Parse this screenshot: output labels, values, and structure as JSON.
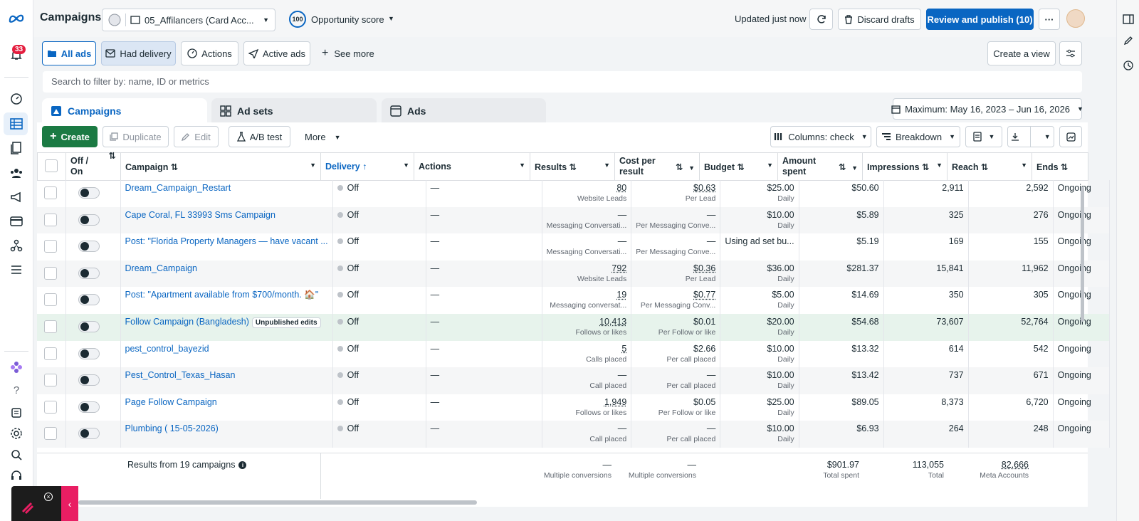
{
  "app": {
    "title": "Campaigns",
    "notif_count": "33"
  },
  "header": {
    "account_name": "05_Affilancers (Card Acc...",
    "opportunity_score": "100",
    "opportunity_label": "Opportunity score",
    "updated": "Updated just now",
    "discard": "Discard drafts",
    "publish": "Review and publish (10)",
    "more": "···"
  },
  "filters": {
    "all_ads": "All ads",
    "had_delivery": "Had delivery",
    "actions": "Actions",
    "active_ads": "Active ads",
    "see_more": "See more",
    "create_view": "Create a view"
  },
  "search": {
    "placeholder": "Search to filter by: name, ID or metrics"
  },
  "levels": {
    "campaigns": "Campaigns",
    "adsets": "Ad sets",
    "ads": "Ads"
  },
  "date_range": "Maximum: May 16, 2023 – Jun 16, 2026",
  "toolbar": {
    "create": "Create",
    "duplicate": "Duplicate",
    "edit": "Edit",
    "ab_test": "A/B test",
    "more": "More",
    "columns": "Columns: check",
    "breakdown": "Breakdown"
  },
  "columns": {
    "offon": "Off / On",
    "campaign": "Campaign",
    "delivery": "Delivery",
    "actions": "Actions",
    "results": "Results",
    "cost": "Cost per result",
    "budget": "Budget",
    "amount": "Amount spent",
    "impressions": "Impressions",
    "reach": "Reach",
    "ends": "Ends"
  },
  "rows": [
    {
      "name": "Dream_Campaign_Restart",
      "delivery": "Off",
      "actions": "—",
      "results": "80",
      "results_sub": "Website Leads",
      "cost": "$0.63",
      "cost_sub": "Per Lead",
      "budget": "$25.00",
      "budget_sub": "Daily",
      "amount": "$50.60",
      "impressions": "2,911",
      "reach": "2,592",
      "ends": "Ongoing"
    },
    {
      "name": "Cape Coral, FL 33993 Sms Campaign",
      "delivery": "Off",
      "actions": "—",
      "results": "—",
      "results_sub": "Messaging Conversati...",
      "cost": "—",
      "cost_sub": "Per Messaging Conve...",
      "budget": "$10.00",
      "budget_sub": "Daily",
      "amount": "$5.89",
      "impressions": "325",
      "reach": "276",
      "ends": "Ongoing"
    },
    {
      "name": "Post: \"Florida Property Managers — have vacant ...",
      "delivery": "Off",
      "actions": "—",
      "results": "—",
      "results_sub": "Messaging Conversati...",
      "cost": "—",
      "cost_sub": "Per Messaging Conve...",
      "budget": "Using ad set bu...",
      "budget_sub": "",
      "amount": "$5.19",
      "impressions": "169",
      "reach": "155",
      "ends": "Ongoing"
    },
    {
      "name": "Dream_Campaign",
      "delivery": "Off",
      "actions": "—",
      "results": "792",
      "results_sub": "Website Leads",
      "cost": "$0.36",
      "cost_sub": "Per Lead",
      "budget": "$36.00",
      "budget_sub": "Daily",
      "amount": "$281.37",
      "impressions": "15,841",
      "reach": "11,962",
      "ends": "Ongoing"
    },
    {
      "name": "Post: \"Apartment available from $700/month. 🏠\"",
      "delivery": "Off",
      "actions": "—",
      "results": "19",
      "results_sub": "Messaging conversat...",
      "cost": "$0.77",
      "cost_sub": "Per Messaging Conv...",
      "budget": "$5.00",
      "budget_sub": "Daily",
      "amount": "$14.69",
      "impressions": "350",
      "reach": "305",
      "ends": "Ongoing"
    },
    {
      "name": "Follow Campaign (Bangladesh)",
      "badge": "Unpublished edits",
      "delivery": "Off",
      "actions": "—",
      "results": "10,413",
      "results_sub": "Follows or likes",
      "cost": "$0.01",
      "cost_sub": "Per Follow or like",
      "budget": "$20.00",
      "budget_sub": "Daily",
      "amount": "$54.68",
      "impressions": "73,607",
      "reach": "52,764",
      "ends": "Ongoing"
    },
    {
      "name": "pest_control_bayezid",
      "delivery": "Off",
      "actions": "—",
      "results": "5",
      "results_sub": "Calls placed",
      "cost": "$2.66",
      "cost_sub": "Per call placed",
      "budget": "$10.00",
      "budget_sub": "Daily",
      "amount": "$13.32",
      "impressions": "614",
      "reach": "542",
      "ends": "Ongoing"
    },
    {
      "name": "Pest_Control_Texas_Hasan",
      "delivery": "Off",
      "actions": "—",
      "results": "—",
      "results_sub": "Call placed",
      "cost": "—",
      "cost_sub": "Per call placed",
      "budget": "$10.00",
      "budget_sub": "Daily",
      "amount": "$13.42",
      "impressions": "737",
      "reach": "671",
      "ends": "Ongoing"
    },
    {
      "name": "Page Follow Campaign",
      "delivery": "Off",
      "actions": "—",
      "results": "1,949",
      "results_sub": "Follows or likes",
      "cost": "$0.05",
      "cost_sub": "Per Follow or like",
      "budget": "$25.00",
      "budget_sub": "Daily",
      "amount": "$89.05",
      "impressions": "8,373",
      "reach": "6,720",
      "ends": "Ongoing"
    },
    {
      "name": "Plumbing ( 15-05-2026)",
      "delivery": "Off",
      "actions": "—",
      "results": "—",
      "results_sub": "Call placed",
      "cost": "—",
      "cost_sub": "Per call placed",
      "budget": "$10.00",
      "budget_sub": "Daily",
      "amount": "$6.93",
      "impressions": "264",
      "reach": "248",
      "ends": "Ongoing"
    }
  ],
  "totals": {
    "label": "Results from 19 campaigns",
    "results": "—",
    "results_sub": "Multiple conversions",
    "cost": "—",
    "cost_sub": "Multiple conversions",
    "amount": "$901.97",
    "amount_sub": "Total spent",
    "impressions": "113,055",
    "impressions_sub": "Total",
    "reach": "82,666",
    "reach_sub": "Meta Accounts"
  },
  "colors": {
    "brand": "#0a66c2",
    "create": "#1b7a43",
    "publish": "#0a66c2"
  }
}
